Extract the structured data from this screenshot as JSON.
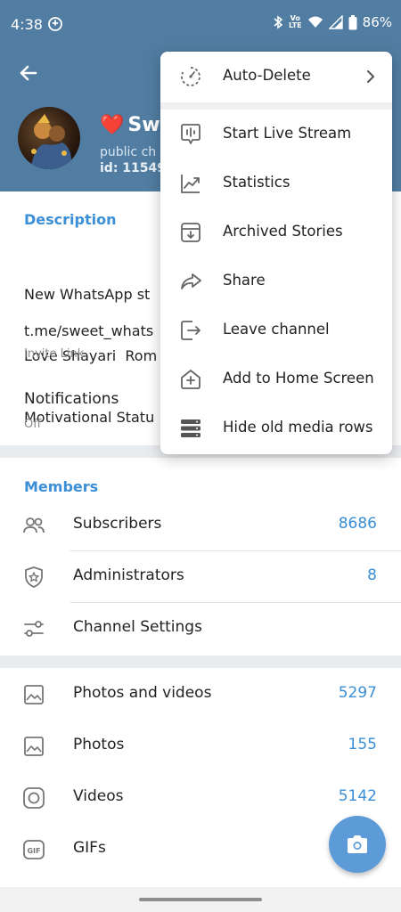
{
  "status_bar": {
    "time": "4:38",
    "network_label": "LTE",
    "battery": "86%"
  },
  "channel": {
    "name_emoji": "❤️",
    "name": "Swe",
    "subtitle": "public ch",
    "id_text": "id: 11549"
  },
  "info": {
    "description_title": "Description",
    "description_lines": [
      "New WhatsApp st",
      "Love Shayari  Rom",
      "Motivational Statu"
    ],
    "link": "t.me/sweet_whats",
    "link_caption": "Invite Link",
    "notifications_label": "Notifications",
    "notifications_value": "Off"
  },
  "members": {
    "title": "Members",
    "rows": [
      {
        "label": "Subscribers",
        "value": "8686",
        "icon": "subscribers-icon"
      },
      {
        "label": "Administrators",
        "value": "8",
        "icon": "shield-star-icon"
      },
      {
        "label": "Channel Settings",
        "value": "",
        "icon": "sliders-icon"
      }
    ]
  },
  "media": {
    "rows": [
      {
        "label": "Photos and videos",
        "value": "5297",
        "icon": "image-icon"
      },
      {
        "label": "Photos",
        "value": "155",
        "icon": "image-icon"
      },
      {
        "label": "Videos",
        "value": "5142",
        "icon": "video-icon"
      },
      {
        "label": "GIFs",
        "value": "",
        "icon": "gif-icon"
      }
    ]
  },
  "menu": {
    "items": [
      {
        "label": "Auto-Delete",
        "icon": "timer-icon"
      },
      {
        "label": "Start Live Stream",
        "icon": "live-stream-icon"
      },
      {
        "label": "Statistics",
        "icon": "statistics-icon"
      },
      {
        "label": "Archived Stories",
        "icon": "archive-icon"
      },
      {
        "label": "Share",
        "icon": "share-icon"
      },
      {
        "label": "Leave channel",
        "icon": "leave-icon"
      },
      {
        "label": "Add to Home Screen",
        "icon": "add-home-icon"
      },
      {
        "label": "Hide old media rows",
        "icon": "rows-icon"
      }
    ]
  },
  "colors": {
    "header": "#517da2",
    "accent": "#3a8fd6",
    "fab": "#5c9bd8"
  }
}
